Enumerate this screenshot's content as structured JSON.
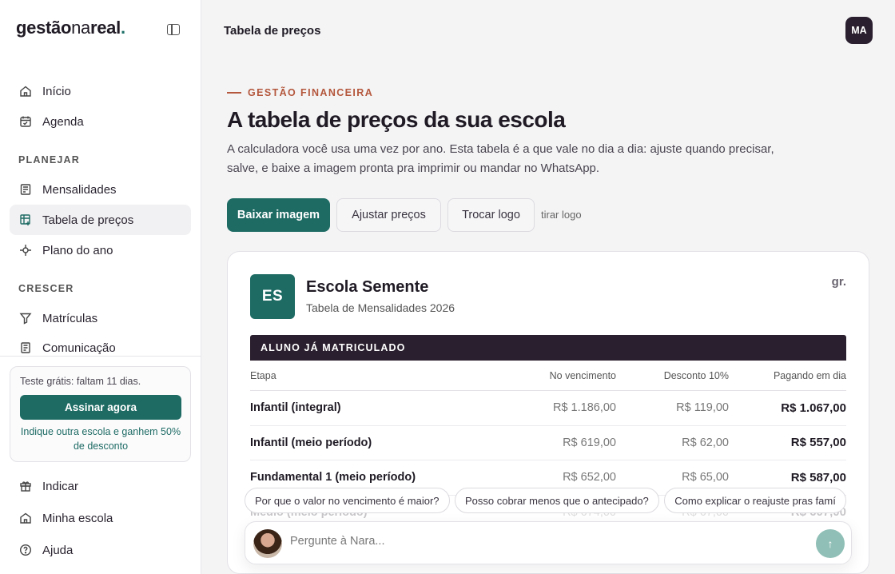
{
  "sidebar": {
    "logo": {
      "part1": "gestão",
      "part2": "na",
      "part3": "real",
      "dot": "."
    },
    "items": [
      {
        "label": "Início",
        "icon": "home-icon"
      },
      {
        "label": "Agenda",
        "icon": "calendar-icon"
      }
    ],
    "sections": [
      {
        "title": "PLANEJAR",
        "items": [
          {
            "label": "Mensalidades",
            "icon": "receipt-icon"
          },
          {
            "label": "Tabela de preços",
            "icon": "table-edit-icon",
            "active": true
          },
          {
            "label": "Plano do ano",
            "icon": "target-icon"
          }
        ]
      },
      {
        "title": "CRESCER",
        "items": [
          {
            "label": "Matrículas",
            "icon": "funnel-icon"
          },
          {
            "label": "Comunicação",
            "icon": "document-icon"
          }
        ]
      }
    ],
    "trial": {
      "text": "Teste grátis: faltam 11 dias.",
      "button": "Assinar agora",
      "refer": "Indique outra escola e ganhem 50% de desconto"
    },
    "bottom_items": [
      {
        "label": "Indicar",
        "icon": "gift-icon"
      },
      {
        "label": "Minha escola",
        "icon": "school-icon"
      },
      {
        "label": "Ajuda",
        "icon": "help-icon"
      }
    ]
  },
  "header": {
    "title": "Tabela de preços",
    "avatar": "MA"
  },
  "main": {
    "eyebrow": "GESTÃO FINANCEIRA",
    "title": "A tabela de preços da sua escola",
    "description": "A calculadora você usa uma vez por ano. Esta tabela é a que vale no dia a dia: ajuste quando precisar, salve, e baixe a imagem pronta pra imprimir ou mandar no WhatsApp.",
    "actions": {
      "download": "Baixar imagem",
      "adjust": "Ajustar preços",
      "logo": "Trocar logo",
      "remove_logo": "tirar logo"
    }
  },
  "card": {
    "badge": "ES",
    "school_name": "Escola Semente",
    "subtitle": "Tabela de Mensalidades 2026",
    "logo_text": "gr.",
    "section_title": "ALUNO JÁ MATRICULADO",
    "columns": [
      "Etapa",
      "No vencimento",
      "Desconto 10%",
      "Pagando em dia"
    ],
    "rows": [
      [
        "Infantil (integral)",
        "R$ 1.186,00",
        "R$ 119,00",
        "R$ 1.067,00"
      ],
      [
        "Infantil (meio período)",
        "R$ 619,00",
        "R$ 62,00",
        "R$ 557,00"
      ],
      [
        "Fundamental 1 (meio período)",
        "R$ 652,00",
        "R$ 65,00",
        "R$ 587,00"
      ],
      [
        "Médio (meio período)",
        "R$ 674,00",
        "R$ 67,00",
        "R$ 607,00"
      ]
    ]
  },
  "chat": {
    "suggestions": [
      "Por que o valor no vencimento é maior?",
      "Posso cobrar menos que o antecipado?",
      "Como explicar o reajuste pras famí"
    ],
    "placeholder": "Pergunte à Nara...",
    "send_icon": "↑"
  },
  "colors": {
    "accent": "#1e6b64",
    "dark": "#2a1f2e",
    "eyebrow": "#b4573c"
  }
}
